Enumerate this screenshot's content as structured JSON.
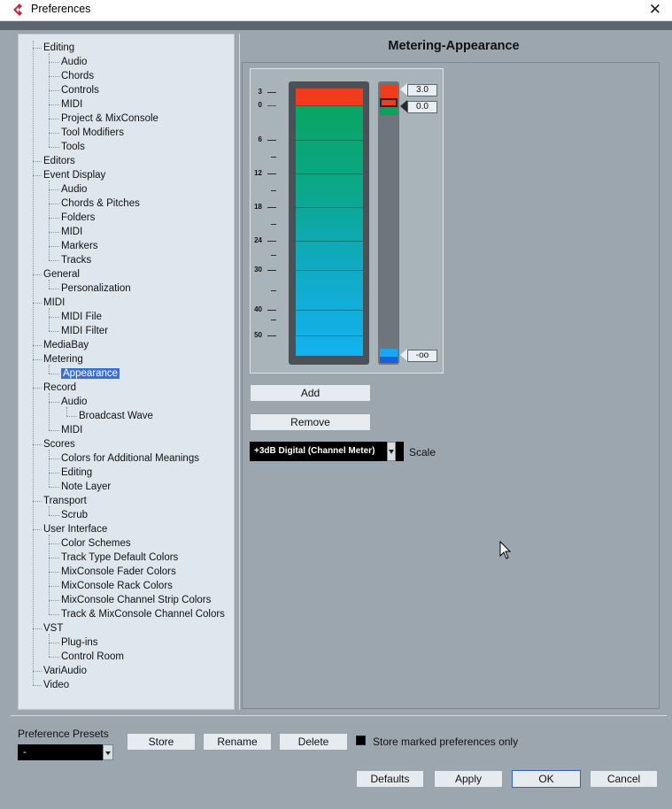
{
  "window": {
    "title": "Preferences",
    "close_symbol": "✕"
  },
  "tree": [
    {
      "label": "Editing",
      "level": 0
    },
    {
      "label": "Audio",
      "level": 1
    },
    {
      "label": "Chords",
      "level": 1
    },
    {
      "label": "Controls",
      "level": 1
    },
    {
      "label": "MIDI",
      "level": 1
    },
    {
      "label": "Project & MixConsole",
      "level": 1
    },
    {
      "label": "Tool Modifiers",
      "level": 1
    },
    {
      "label": "Tools",
      "level": 1
    },
    {
      "label": "Editors",
      "level": 0
    },
    {
      "label": "Event Display",
      "level": 0
    },
    {
      "label": "Audio",
      "level": 1
    },
    {
      "label": "Chords & Pitches",
      "level": 1
    },
    {
      "label": "Folders",
      "level": 1
    },
    {
      "label": "MIDI",
      "level": 1
    },
    {
      "label": "Markers",
      "level": 1
    },
    {
      "label": "Tracks",
      "level": 1
    },
    {
      "label": "General",
      "level": 0
    },
    {
      "label": "Personalization",
      "level": 1
    },
    {
      "label": "MIDI",
      "level": 0
    },
    {
      "label": "MIDI File",
      "level": 1
    },
    {
      "label": "MIDI Filter",
      "level": 1
    },
    {
      "label": "MediaBay",
      "level": 0
    },
    {
      "label": "Metering",
      "level": 0
    },
    {
      "label": "Appearance",
      "level": 1,
      "selected": true
    },
    {
      "label": "Record",
      "level": 0
    },
    {
      "label": "Audio",
      "level": 1
    },
    {
      "label": "Broadcast Wave",
      "level": 2
    },
    {
      "label": "MIDI",
      "level": 1
    },
    {
      "label": "Scores",
      "level": 0
    },
    {
      "label": "Colors for Additional Meanings",
      "level": 1
    },
    {
      "label": "Editing",
      "level": 1
    },
    {
      "label": "Note Layer",
      "level": 1
    },
    {
      "label": "Transport",
      "level": 0
    },
    {
      "label": "Scrub",
      "level": 1
    },
    {
      "label": "User Interface",
      "level": 0
    },
    {
      "label": "Color Schemes",
      "level": 1
    },
    {
      "label": "Track Type Default Colors",
      "level": 1
    },
    {
      "label": "MixConsole Fader Colors",
      "level": 1
    },
    {
      "label": "MixConsole Rack Colors",
      "level": 1
    },
    {
      "label": "MixConsole Channel Strip Colors",
      "level": 1
    },
    {
      "label": "Track & MixConsole Channel Colors",
      "level": 1
    },
    {
      "label": "VST",
      "level": 0
    },
    {
      "label": "Plug-ins",
      "level": 1
    },
    {
      "label": "Control Room",
      "level": 1
    },
    {
      "label": "VariAudio",
      "level": 0
    },
    {
      "label": "Video",
      "level": 0
    }
  ],
  "panel": {
    "title": "Metering-Appearance",
    "meter_scale": [
      "3",
      "0",
      "6",
      "12",
      "18",
      "24",
      "30",
      "40",
      "50"
    ],
    "handles": [
      "3.0",
      "0.0",
      "-oo"
    ],
    "add_label": "Add",
    "remove_label": "Remove",
    "scale_select": "+3dB Digital (Channel Meter)",
    "scale_label": "Scale"
  },
  "bottom": {
    "presets_label": "Preference Presets",
    "presets_value": "-",
    "store_label": "Store",
    "rename_label": "Rename",
    "delete_label": "Delete",
    "store_marked_label": "Store marked preferences only",
    "store_marked_checked": true,
    "defaults_label": "Defaults",
    "apply_label": "Apply",
    "ok_label": "OK",
    "cancel_label": "Cancel"
  },
  "colors": {
    "peak_red": "#f13b1d",
    "meter_green": "#0aa35c",
    "meter_cyan": "#12b2f0",
    "selection_blue": "#3d6fd0"
  }
}
